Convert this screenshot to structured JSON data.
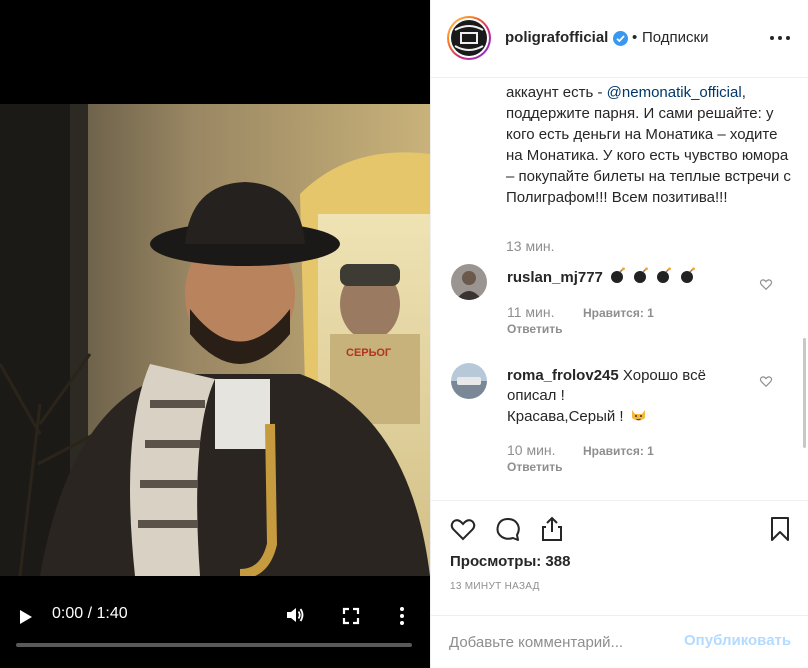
{
  "video": {
    "time_display": "0:00 / 1:40",
    "progress_fraction": 0.0,
    "icons": {
      "play": "play-icon",
      "volume": "volume-icon",
      "fullscreen": "fullscreen-icon",
      "more": "more-vertical-icon"
    }
  },
  "header": {
    "username": "poligrafofficial",
    "separator": "•",
    "follow_label": "Подписки",
    "verified": true
  },
  "caption": {
    "text_before": "аккаунт есть - ",
    "mention": "@nemonatik_official",
    "text_after": ", поддержите парня. И сами решайте: у кого есть деньги на Монатика – ходите на Монатика. У кого есть чувство юмора – покупайте билеты на теплые встречи с Полиграфом!!! Всем позитива!!!",
    "time": "13 мин."
  },
  "comments": [
    {
      "username": "ruslan_mj777",
      "text": "",
      "emoji": [
        "bomb",
        "bomb",
        "bomb",
        "bomb"
      ],
      "time": "11 мин.",
      "likes": "Нравится: 1",
      "reply": "Ответить"
    },
    {
      "username": "roma_frolov245",
      "text_line1": " Хорошо всё описал !",
      "text_line2": "Красава,Серый !",
      "time": "10 мин.",
      "likes": "Нравится: 1",
      "reply": "Ответить"
    }
  ],
  "actions": {
    "views": "Просмотры: 388",
    "posted": "13 МИНУТ НАЗАД"
  },
  "add_comment": {
    "placeholder": "Добавьте комментарий...",
    "publish_label": "Опубликовать"
  },
  "colors": {
    "link": "#00376b",
    "muted": "#8e8e8e",
    "publish_disabled": "#b3dbff",
    "verified_badge": "#3897f0"
  }
}
